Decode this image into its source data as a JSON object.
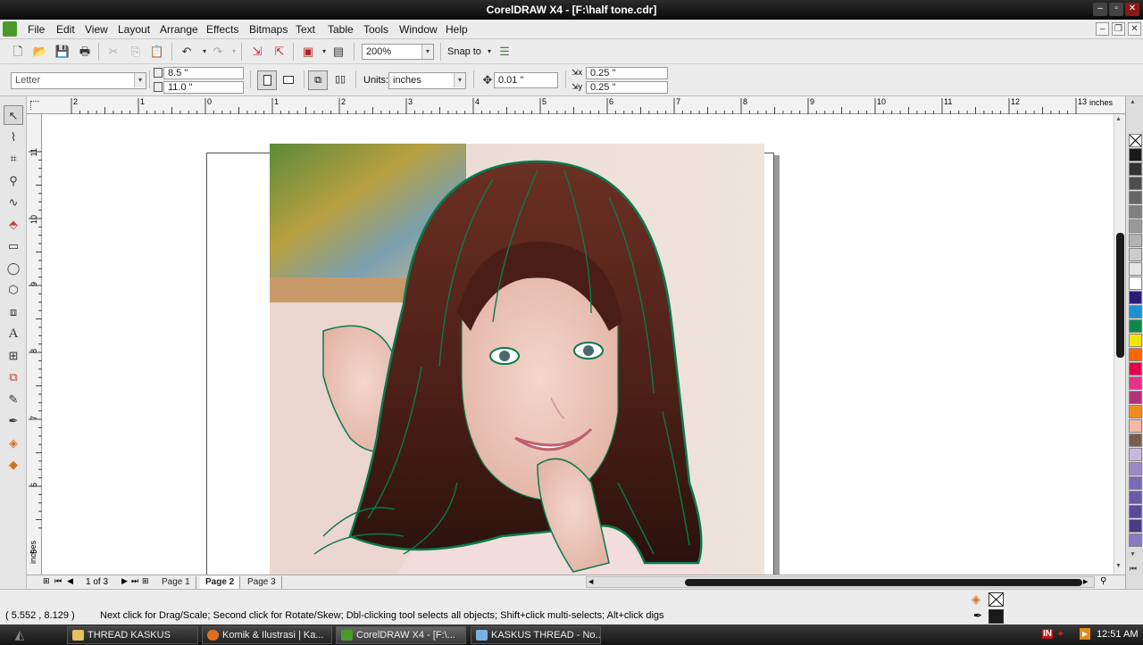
{
  "window": {
    "title": "CorelDRAW X4 - [F:\\half tone.cdr]"
  },
  "menu": [
    "File",
    "Edit",
    "View",
    "Layout",
    "Arrange",
    "Effects",
    "Bitmaps",
    "Text",
    "Table",
    "Tools",
    "Window",
    "Help"
  ],
  "standard_toolbar": {
    "zoom_value": "200%",
    "snap_to_label": "Snap to"
  },
  "property_bar": {
    "paper_type": "Letter",
    "width": "8.5 \"",
    "height": "11.0 \"",
    "units_label": "Units:",
    "units_value": "inches",
    "nudge": "0.01 \"",
    "dup_x": "0.25 \"",
    "dup_y": "0.25 \""
  },
  "rulers": {
    "horizontal_ticks": [
      "2",
      "1",
      "0",
      "1",
      "2",
      "3",
      "4",
      "5",
      "6",
      "7",
      "8",
      "9",
      "10",
      "11",
      "12",
      "13"
    ],
    "unit": "inches",
    "vertical_ticks": [
      "11",
      "10",
      "9",
      "8",
      "7",
      "6",
      "5"
    ],
    "vertical_unit": "inches"
  },
  "palette": [
    "#ffffff",
    "#1a1a1a",
    "#333333",
    "#4d4d4d",
    "#666666",
    "#808080",
    "#999999",
    "#b3b3b3",
    "#cccccc",
    "#e6e6e6",
    "#ffffff",
    "#2a1a7a",
    "#1e90d8",
    "#0a8a4a",
    "#f2e600",
    "#ff6600",
    "#e6004d",
    "#e6338a",
    "#b3337a",
    "#f08c1a",
    "#f5b8a8",
    "#7a5c4a",
    "#c8b8e0",
    "#9a8ac8",
    "#7a6ab8",
    "#6a5aa8",
    "#5a4a98",
    "#4a3a88",
    "#8a7ac0"
  ],
  "pages": {
    "count_label": "1 of 3",
    "tabs": [
      "Page 1",
      "Page 2",
      "Page 3"
    ]
  },
  "status": {
    "coords": "( 5.552 , 8.129 )",
    "message": "Next click for Drag/Scale; Second click for Rotate/Skew; Dbl-clicking tool selects all objects; Shift+click multi-selects; Alt+click digs"
  },
  "taskbar": {
    "tasks": [
      "THREAD KASKUS",
      "Komik & Ilustrasi | Ka...",
      "CorelDRAW X4 - [F:\\...",
      "KASKUS THREAD - No..."
    ],
    "language": "IN",
    "clock": "12:51 AM"
  },
  "colors": {
    "outline_green": "#0a7a4a",
    "hair": "#5a2a1e"
  }
}
